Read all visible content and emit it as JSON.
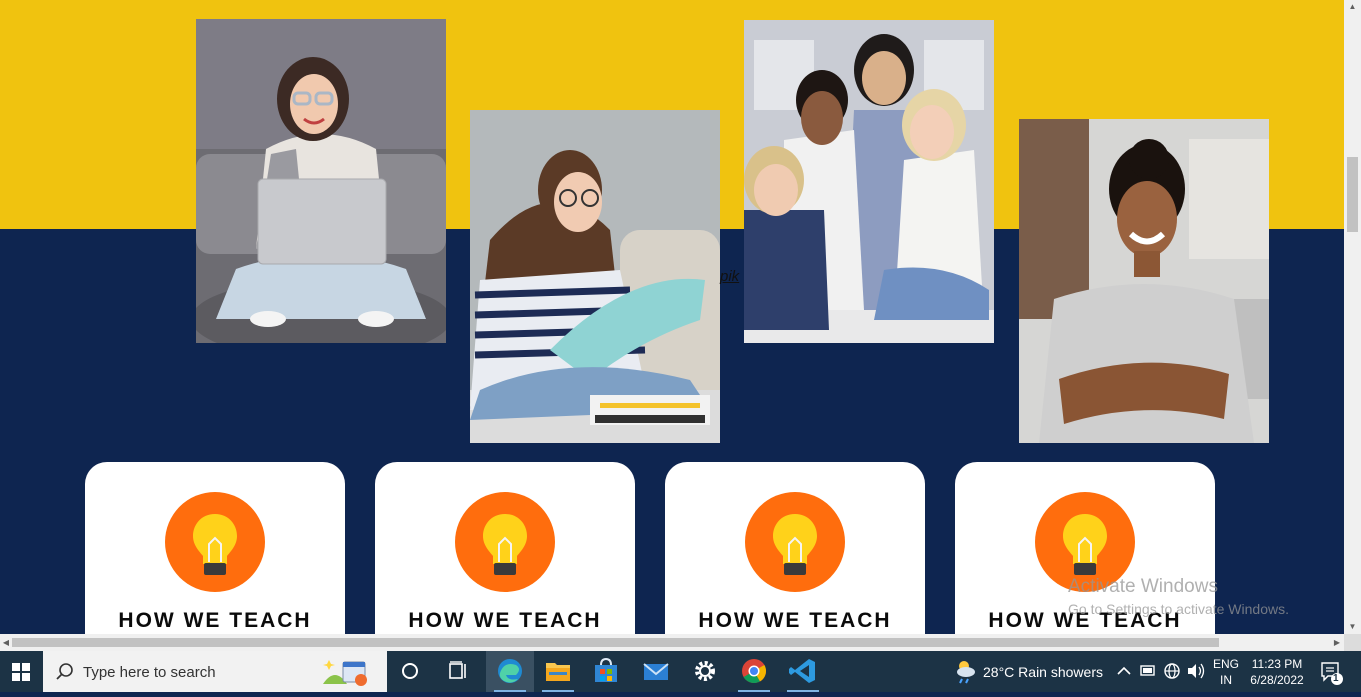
{
  "page": {
    "stray_link_text": "pik",
    "cards": [
      {
        "title": "HOW WE TEACH",
        "icon": "lightbulb-icon"
      },
      {
        "title": "HOW WE TEACH",
        "icon": "lightbulb-icon"
      },
      {
        "title": "HOW WE TEACH",
        "icon": "lightbulb-icon"
      },
      {
        "title": "HOW WE TEACH",
        "icon": "lightbulb-icon"
      }
    ],
    "photos": [
      "student-with-laptop-photo",
      "student-reading-photo",
      "group-of-students-photo",
      "smiling-woman-photo"
    ]
  },
  "watermark": {
    "line1": "Activate Windows",
    "line2": "Go to Settings to activate Windows."
  },
  "taskbar": {
    "search_placeholder": "Type here to search",
    "weather": "28°C  Rain showers",
    "lang_top": "ENG",
    "lang_bottom": "IN",
    "time": "11:23 PM",
    "date": "6/28/2022",
    "notification_count": "1"
  },
  "colors": {
    "yellow": "#f0c30f",
    "navy": "#0e2550",
    "orange": "#ff6d0d",
    "bulb": "#ffd21a"
  }
}
